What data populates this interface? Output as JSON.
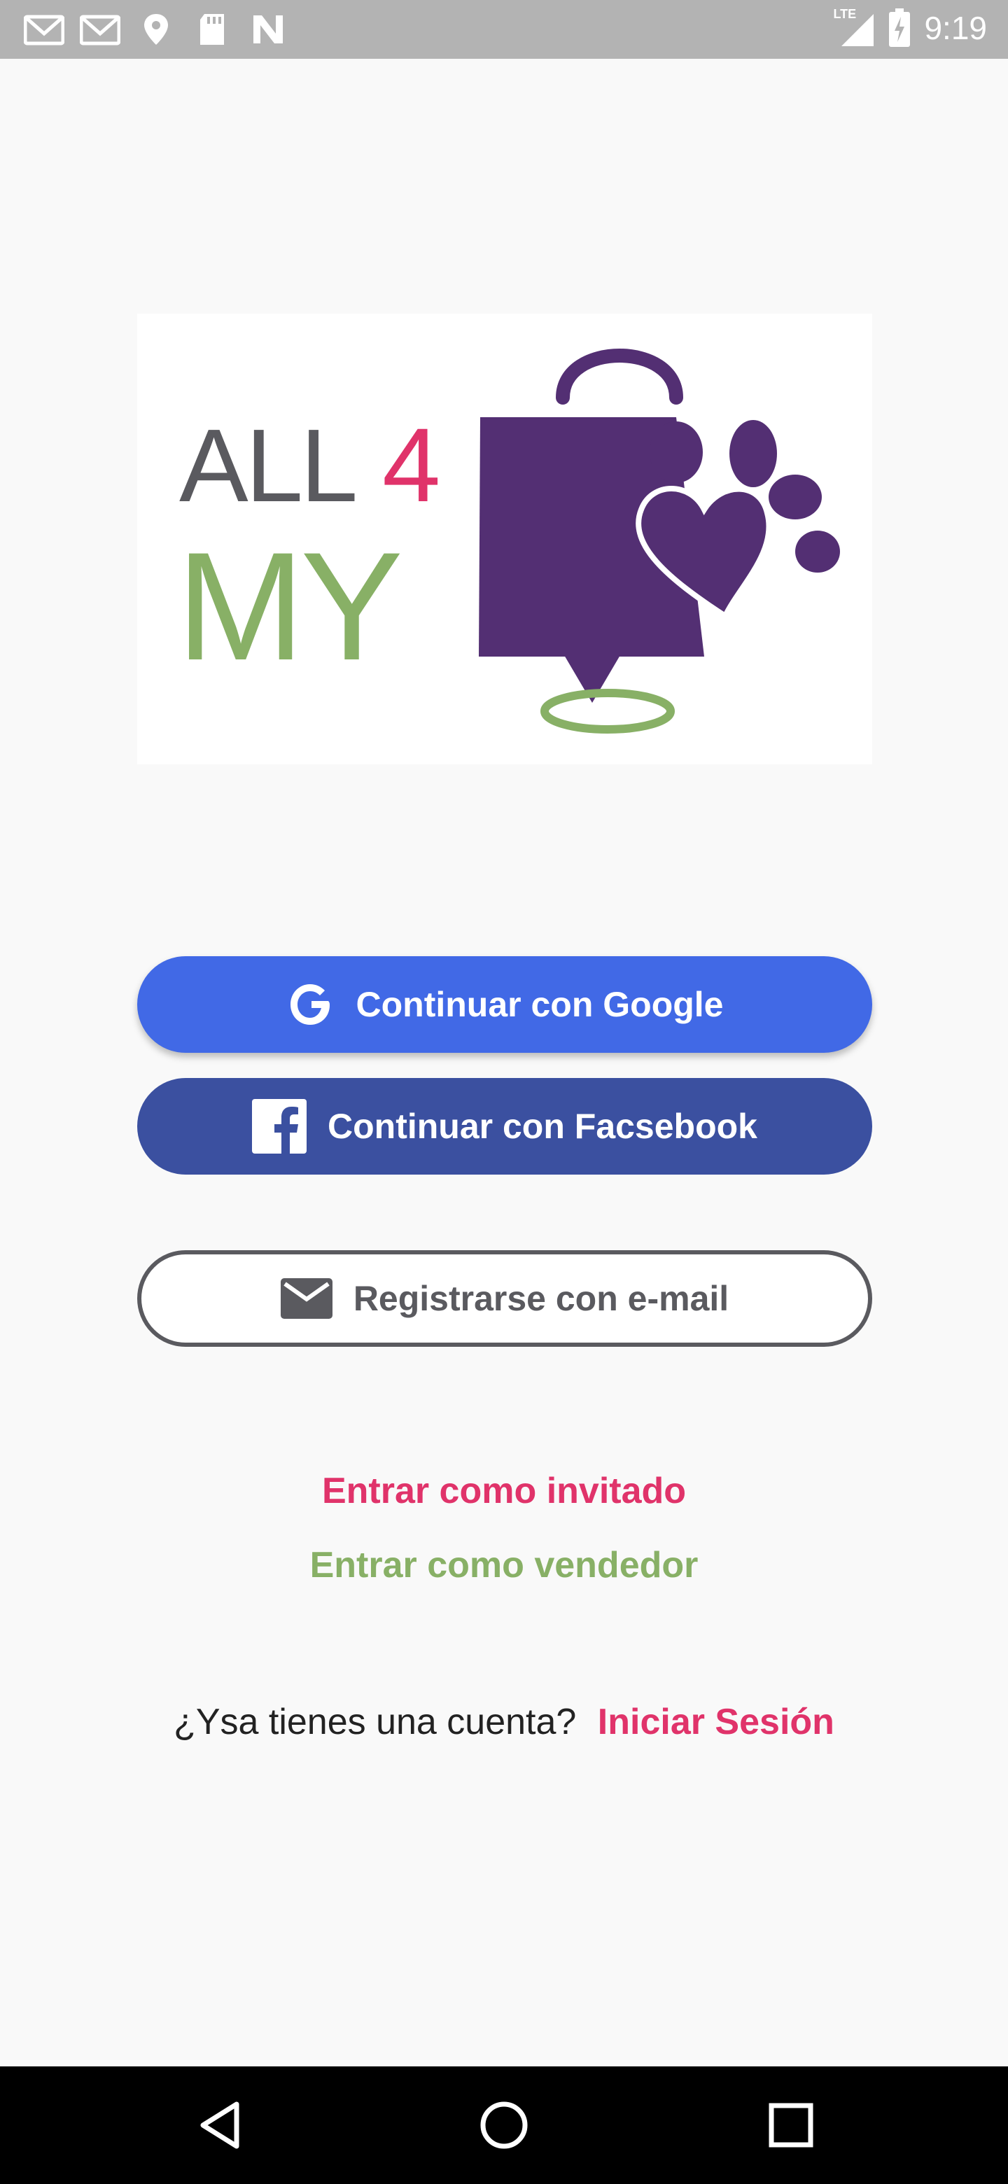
{
  "status_bar": {
    "time": "9:19",
    "network": "LTE",
    "icons_left": [
      "gmail-icon",
      "gmail-icon",
      "location-icon",
      "sd-card-icon",
      "n-icon"
    ],
    "icons_right": [
      "signal-icon",
      "battery-icon"
    ]
  },
  "logo": {
    "text_all": "ALL",
    "text_4": "4",
    "text_my": "MY",
    "colors": {
      "gray": "#5a5a5f",
      "pink": "#e0336a",
      "green": "#88b066",
      "purple": "#532f73"
    }
  },
  "buttons": {
    "google": "Continuar con Google",
    "facebook": "Continuar con Facsebook",
    "email": "Registrarse con e-mail"
  },
  "links": {
    "guest": "Entrar como invitado",
    "seller": "Entrar como vendedor"
  },
  "signin": {
    "prompt": "¿Ysa tienes una cuenta?",
    "link": "Iniciar Sesión"
  },
  "nav_bar": {
    "icons": [
      "back-icon",
      "home-icon",
      "recents-icon"
    ]
  },
  "colors": {
    "google_blue": "#4169e6",
    "facebook_blue": "#3b50a0",
    "accent_pink": "#e0336a",
    "accent_green": "#88b066"
  }
}
